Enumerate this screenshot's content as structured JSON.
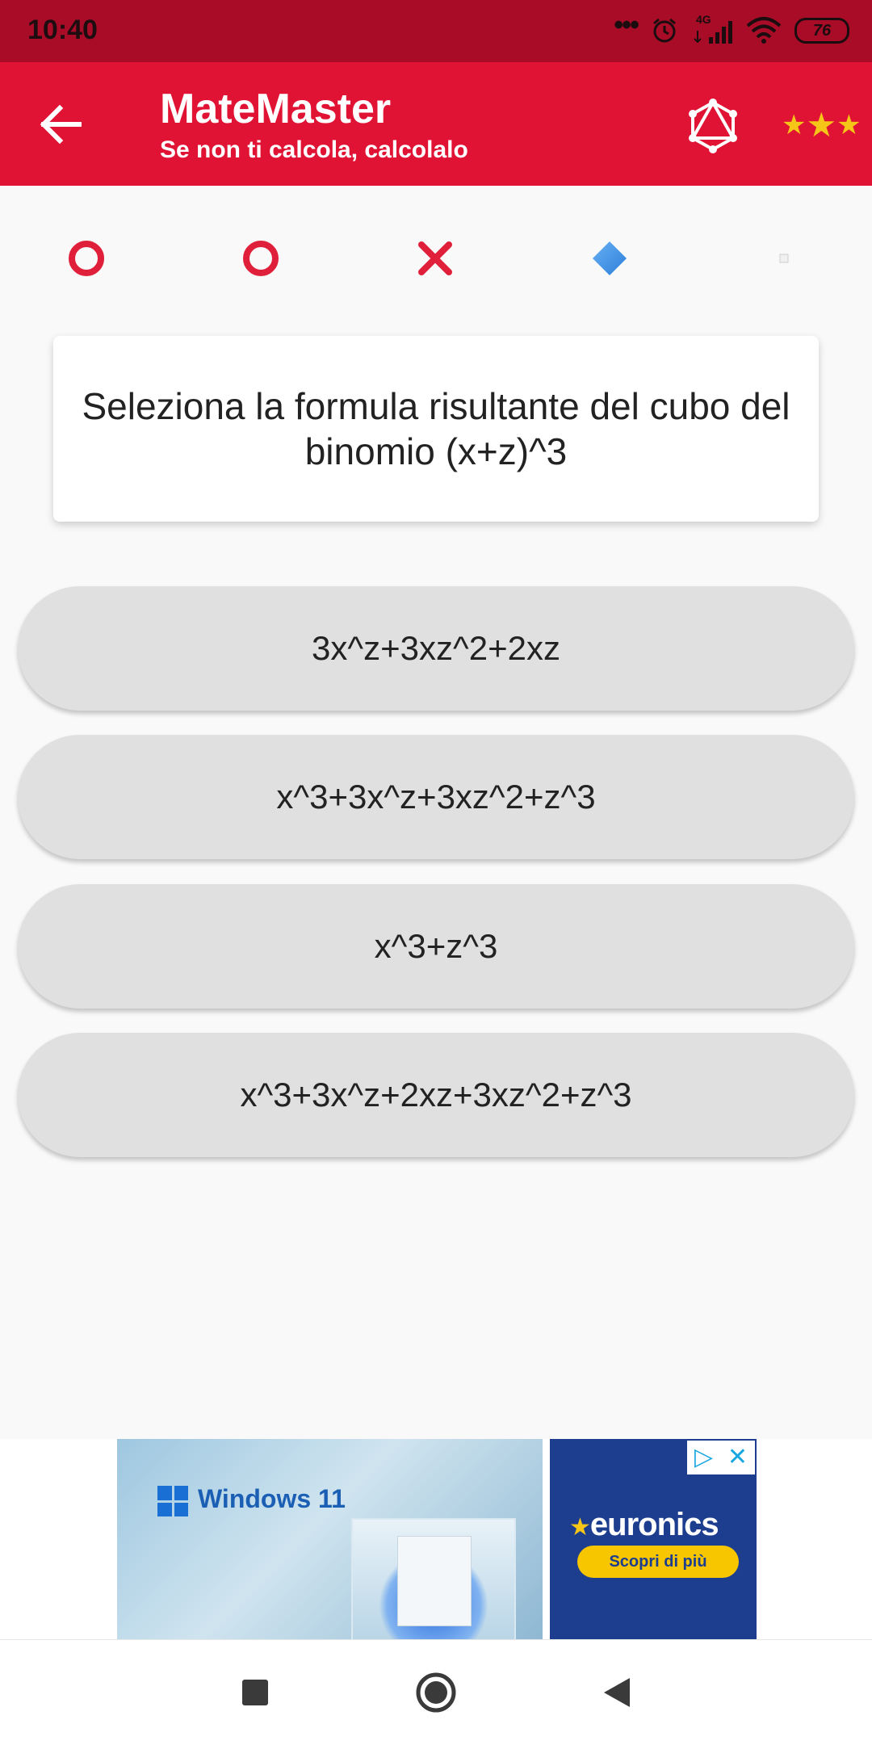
{
  "status_bar": {
    "time": "10:40",
    "signal_label": "4G",
    "battery": "76"
  },
  "app_bar": {
    "title": "MateMaster",
    "subtitle": "Se non ti calcola, calcolalo",
    "accent_color": "#e11335"
  },
  "progress": [
    {
      "icon": "ring-icon",
      "state": "correct"
    },
    {
      "icon": "ring-icon",
      "state": "correct"
    },
    {
      "icon": "cross-icon",
      "state": "wrong"
    },
    {
      "icon": "diamond-icon",
      "state": "current"
    },
    {
      "icon": "small-square-icon",
      "state": "pending"
    }
  ],
  "question": {
    "text": "Seleziona la formula risultante del cubo del binomio (x+z)^3"
  },
  "answers": [
    {
      "label": "3x^z+3xz^2+2xz"
    },
    {
      "label": "x^3+3x^z+3xz^2+z^3"
    },
    {
      "label": "x^3+z^3"
    },
    {
      "label": "x^3+3x^z+2xz+3xz^2+z^3"
    }
  ],
  "ad": {
    "left_brand": "Windows 11",
    "right_brand": "euronics",
    "cta": "Scopri di più"
  }
}
